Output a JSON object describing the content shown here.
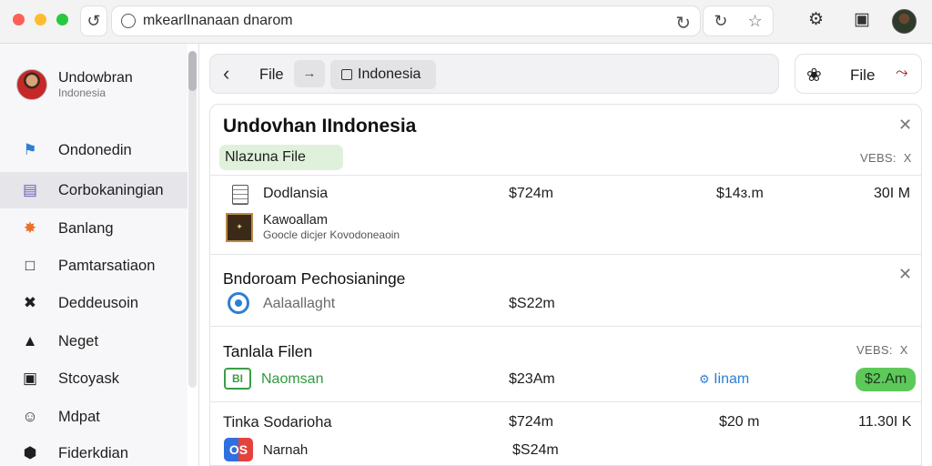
{
  "browser": {
    "url": "mkearlInanaan dnarom",
    "back_icon": "refresh-back-icon",
    "colors": {
      "close": "#fe5f57",
      "minimize": "#febc2e",
      "maximize": "#28c840"
    }
  },
  "sidebar": {
    "user": {
      "name": "Undowbran",
      "subtitle": "Indonesia"
    },
    "items": [
      {
        "label": "Ondonedin",
        "icon": "flag-icon",
        "color": "#2f7fd1"
      },
      {
        "label": "Corbokaningian",
        "icon": "bookmark-icon",
        "color": "#6b5fb5",
        "active": true
      },
      {
        "label": "Banlang",
        "icon": "burst-icon",
        "color": "#e8712b"
      },
      {
        "label": "Pamtarsatiaon",
        "icon": "window-icon",
        "color": "#333333"
      },
      {
        "label": "Deddeusoin",
        "icon": "tools-icon",
        "color": "#333333"
      },
      {
        "label": "Neget",
        "icon": "warning-icon",
        "color": "#333333"
      },
      {
        "label": "Stcoyask",
        "icon": "lock-icon",
        "color": "#333333"
      },
      {
        "label": "Mdpat",
        "icon": "person-icon",
        "color": "#333333"
      },
      {
        "label": "Fiderkdian",
        "icon": "shield-icon",
        "color": "#333333"
      }
    ]
  },
  "toolbar": {
    "file_label": "File",
    "arrow": "→",
    "chip_label": "Indonesia",
    "right_file_label": "File"
  },
  "panel": {
    "title": "Undovhan IIndonesia",
    "chip": "Nlazuna File",
    "vers": "VEBS:",
    "vers_x": "X",
    "rows_top": [
      {
        "name": "Dodlansia",
        "v1": "$724m",
        "v2": "$14ɜ.m",
        "v3": "30I M"
      },
      {
        "name": "Kawoallam",
        "sub": "Goocle dicjer Kovodoneaoin"
      }
    ],
    "section2": {
      "title": "Bndoroam Pechosianinge",
      "row": {
        "name": "Aalaallaght",
        "v1": "$S22m"
      }
    },
    "section3": {
      "title": "Tanlala Filen",
      "vers": "VEBS:",
      "vers_x": "X",
      "row1": {
        "badge": "BI",
        "name": "Naomsan",
        "v1": "$23Am",
        "link": "Iinam",
        "pill": "$2.Am"
      },
      "row2": {
        "name": "Tinka Sodarioha",
        "v1": "$724m",
        "v2": "$20 m",
        "v3": "11.30I K"
      },
      "row3": {
        "badge": "OS",
        "name": "Narnah",
        "v1": "$S24m"
      }
    }
  }
}
